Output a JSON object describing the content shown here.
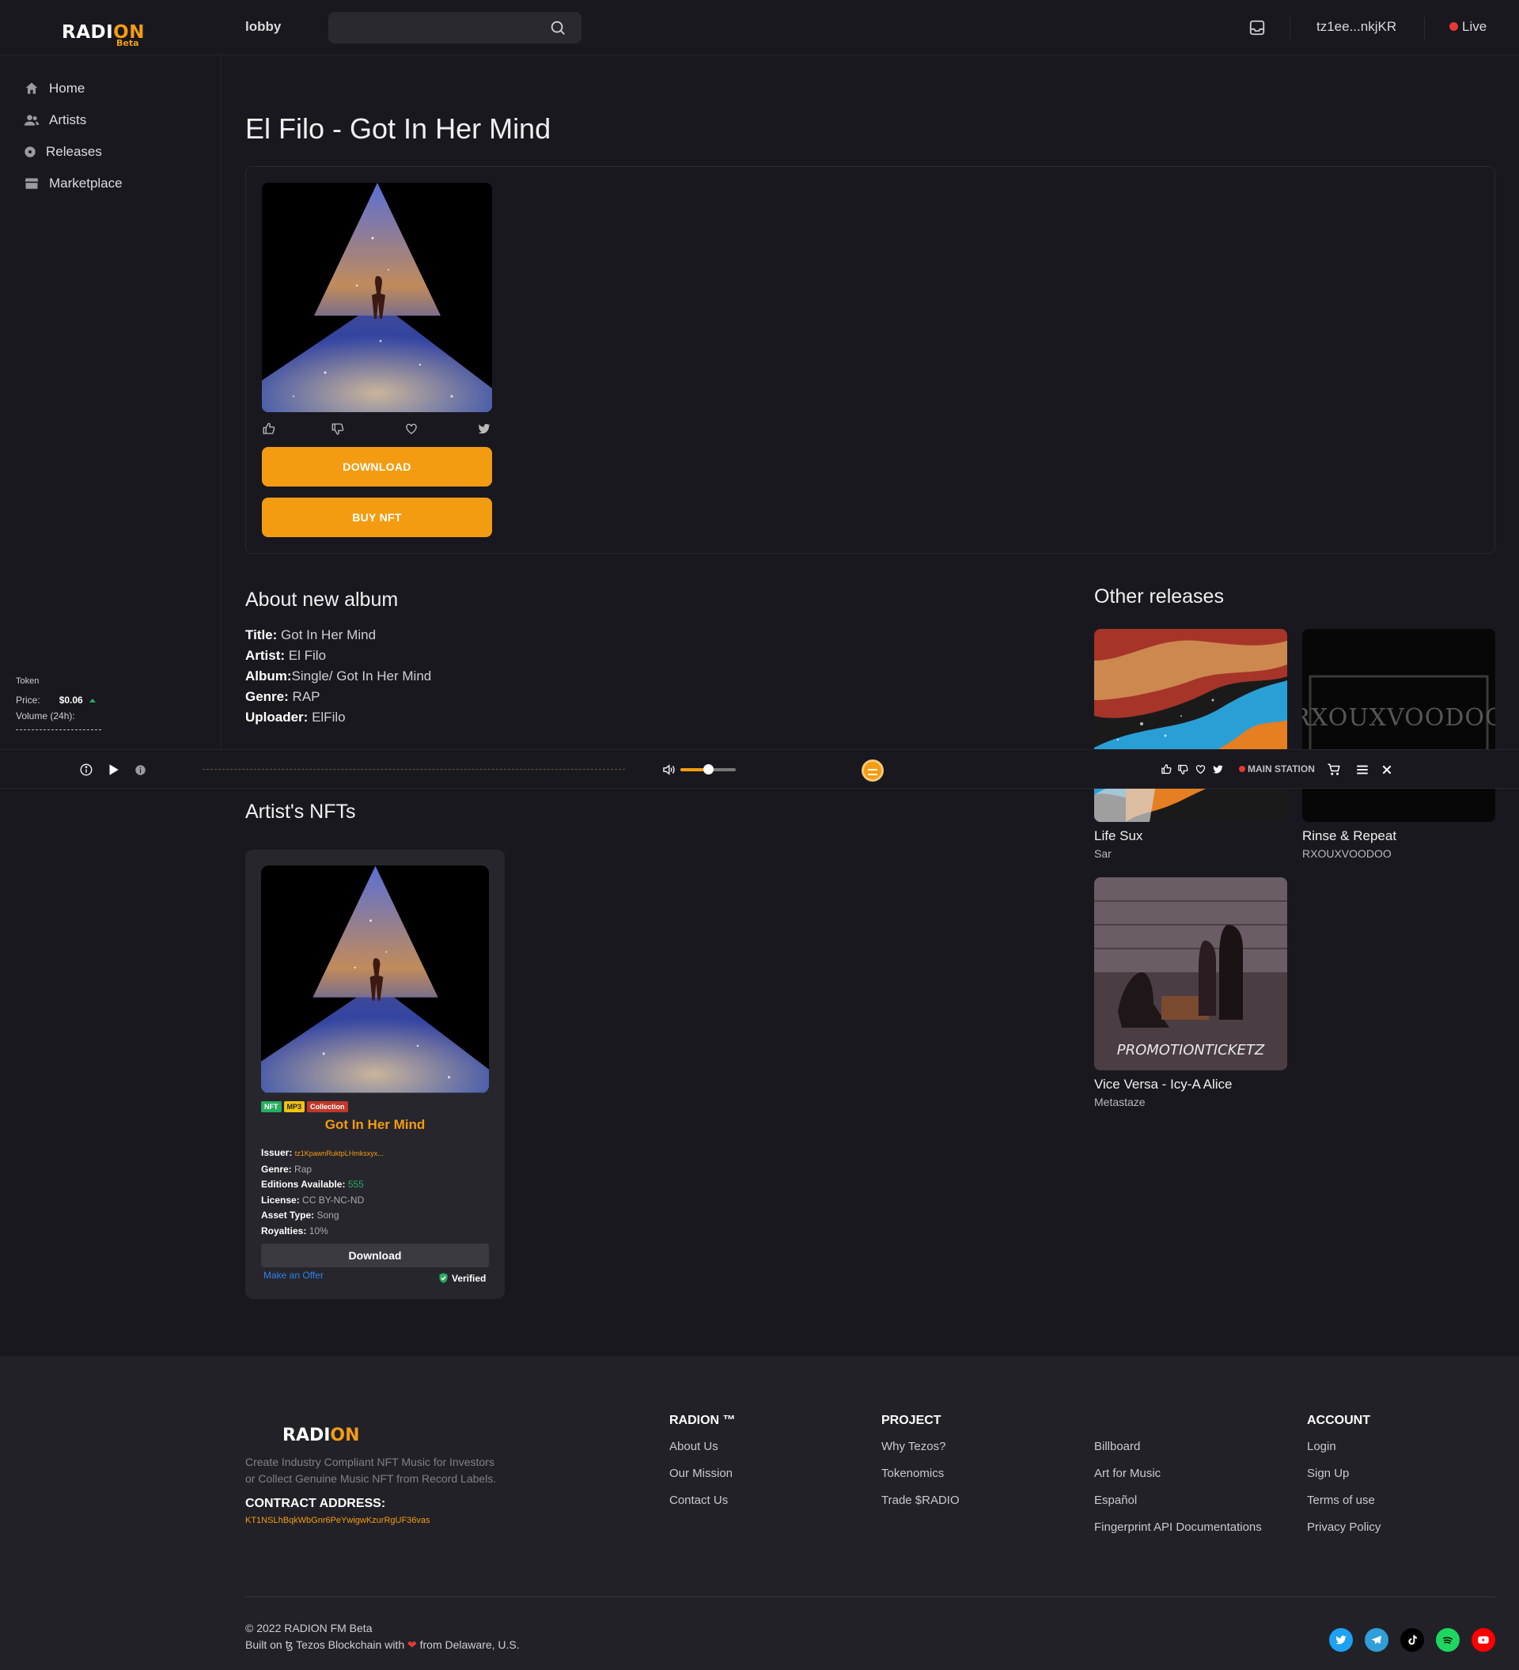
{
  "header": {
    "logo_text": "RADI",
    "logo_accent": "ON",
    "logo_badge": "Beta",
    "lobby": "lobby",
    "search_placeholder": "",
    "wallet": "tz1ee...nkjKR",
    "live": "Live"
  },
  "sidebar": {
    "items": [
      {
        "label": "Home",
        "icon": "home-icon"
      },
      {
        "label": "Artists",
        "icon": "users-icon"
      },
      {
        "label": "Releases",
        "icon": "disc-icon"
      },
      {
        "label": "Marketplace",
        "icon": "store-icon"
      }
    ],
    "token": {
      "label": "Token",
      "price_label": "Price:",
      "price": "$0.06",
      "volume_label": "Volume (24h):"
    }
  },
  "release": {
    "page_title": "El Filo - Got In Her Mind",
    "download_label": "DOWNLOAD",
    "buy_label": "BUY NFT"
  },
  "about": {
    "heading": "About new album",
    "rows": [
      {
        "key": "Title:",
        "value": " Got In Her Mind"
      },
      {
        "key": "Artist:",
        "value": " El Filo"
      },
      {
        "key": "Album:",
        "value": "Single/ Got In Her Mind"
      },
      {
        "key": "Genre:",
        "value": " RAP"
      },
      {
        "key": "Uploader:",
        "value": " ElFilo"
      }
    ]
  },
  "other_releases": {
    "heading": "Other releases",
    "items": [
      {
        "title": "Life Sux",
        "artist": "Sar"
      },
      {
        "title": "Rinse & Repeat",
        "artist": "RXOUXVOODOO",
        "art_text": "RXOUXVOODOO"
      },
      {
        "title": "Vice Versa - Icy-A Alice",
        "artist": "Metastaze",
        "art_text": "PROMOTIONTICKETZ"
      }
    ]
  },
  "player": {
    "station": "MAIN STATION",
    "volume_percent": 50
  },
  "nfts": {
    "heading": "Artist's NFTs",
    "card": {
      "badges": [
        "NFT",
        "MP3",
        "Collection"
      ],
      "title": "Got In Her Mind",
      "issuer_label": "Issuer:",
      "issuer": "tz1KpawnRuktpLHmksxyx...",
      "genre_label": "Genre:",
      "genre": "Rap",
      "editions_label": "Editions Available:",
      "editions": "555",
      "license_label": "License:",
      "license": "CC BY-NC-ND",
      "asset_label": "Asset Type:",
      "asset": "Song",
      "royalties_label": "Royalties:",
      "royalties": "10%",
      "download_label": "Download",
      "offer_label": "Make an Offer",
      "verified_label": "Verified"
    }
  },
  "footer": {
    "logo_text": "RADI",
    "logo_accent": "ON",
    "desc_line1": "Create Industry Compliant NFT Music for Investors",
    "desc_line2": "or Collect Genuine Music NFT from Record Labels.",
    "contract_heading": "CONTRACT ADDRESS:",
    "contract": "KT1NSLhBqkWbGnr6PeYwigwKzurRgUF36vas",
    "col_radion": {
      "heading": "RADION ™",
      "links": [
        "About Us",
        "Our Mission",
        "Contact Us"
      ]
    },
    "col_project": {
      "heading": "PROJECT",
      "links": [
        "Why Tezos?",
        "Tokenomics",
        "Trade $RADIO"
      ]
    },
    "col_more": {
      "heading": "",
      "links": [
        "Billboard",
        "Art for Music",
        "Español",
        "Fingerprint API Documentations"
      ]
    },
    "col_account": {
      "heading": "ACCOUNT",
      "links": [
        "Login",
        "Sign Up",
        "Terms of use",
        "Privacy Policy"
      ]
    },
    "copyright": "© 2022 RADION FM Beta",
    "built_prefix": "Built on ꜩ Tezos Blockchain with",
    "built_suffix": "from Delaware, U.S.",
    "social_colors": {
      "twitter": "#1da1f2",
      "telegram": "#2f9ed9",
      "tiktok": "#000000",
      "spotify": "#1ed760",
      "youtube": "#ff0000"
    }
  },
  "colors": {
    "accent": "#f39c12",
    "background": "#19181e",
    "live": "#e53935",
    "positive": "#27ae60"
  }
}
